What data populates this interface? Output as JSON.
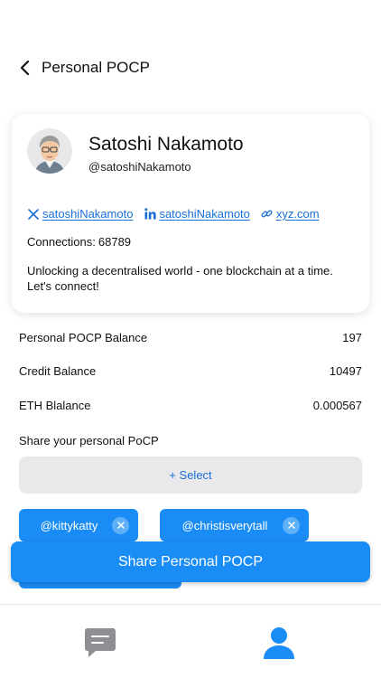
{
  "header": {
    "title": "Personal POCP",
    "back_icon": "chevron-left-icon"
  },
  "profile": {
    "name": "Satoshi Nakamoto",
    "handle": "@satoshiNakamoto",
    "links": [
      {
        "icon": "x-twitter-icon",
        "label": "satoshiNakamoto"
      },
      {
        "icon": "linkedin-icon",
        "label": "satoshiNakamoto"
      },
      {
        "icon": "link-icon",
        "label": "xyz.com"
      }
    ],
    "connections_label": "Connections:",
    "connections_value": "68789",
    "bio": "Unlocking a decentralised world - one blockchain at a time. Let's connect!"
  },
  "balances": [
    {
      "label": "Personal POCP Balance",
      "value": "197"
    },
    {
      "label": "Credit Balance",
      "value": "10497"
    },
    {
      "label": "ETH Blalance",
      "value": "0.000567"
    }
  ],
  "share": {
    "label": "Share your personal PoCP",
    "select_label": "+ Select",
    "recipients": [
      "@kittykatty",
      "@christisverytall"
    ]
  },
  "cta_label": "Share Personal POCP",
  "nav": [
    {
      "icon": "chat-icon",
      "active": false
    },
    {
      "icon": "profile-icon",
      "active": true
    }
  ],
  "colors": {
    "accent": "#1a8cf5",
    "link": "#1a6fd6",
    "inactive_icon": "#8e8e93",
    "select_bg": "#e9e9ec"
  }
}
